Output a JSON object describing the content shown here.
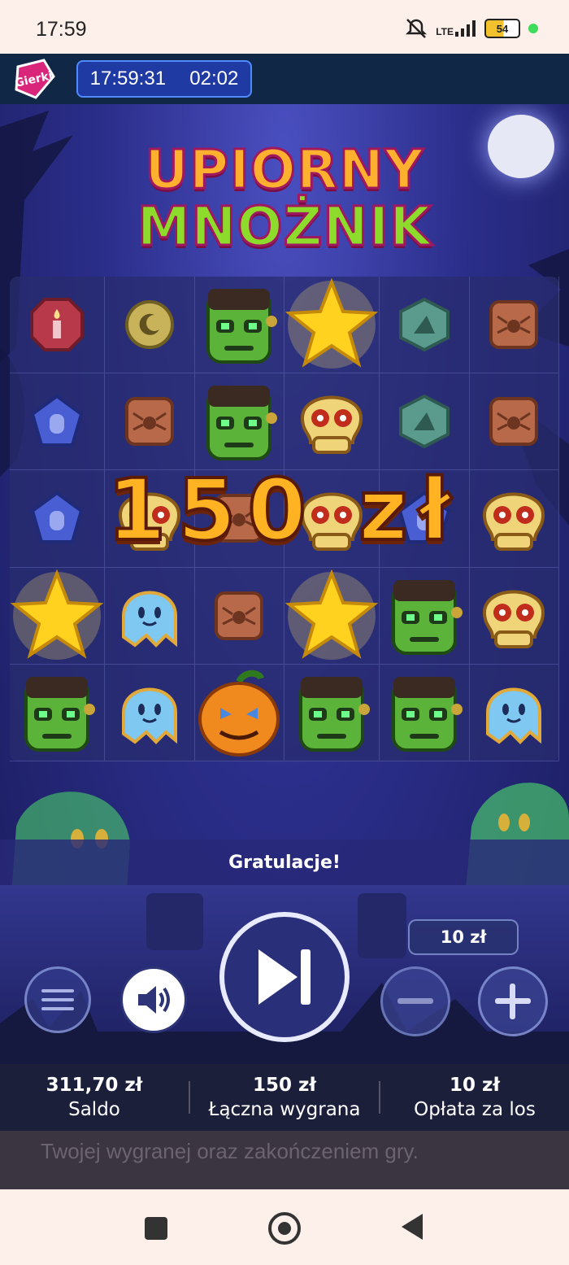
{
  "status_bar": {
    "time": "17:59",
    "network": "LTE",
    "battery": "54"
  },
  "header": {
    "clock_time": "17:59:31",
    "session_timer": "02:02",
    "logo_text": "Gierki"
  },
  "game": {
    "title_line1": "UPIORNY",
    "title_line2": "MNOŻNIK",
    "grid": [
      [
        "candle-gem",
        "moon-coin",
        "frankenstein",
        "star",
        "witch-hat-gem",
        "spider-tile"
      ],
      [
        "tombstone-gem",
        "spider-tile",
        "frankenstein",
        "skull",
        "witch-hat-gem",
        "spider-tile"
      ],
      [
        "tombstone-gem",
        "skull",
        "spider-tile",
        "skull",
        "tombstone-gem",
        "skull"
      ],
      [
        "star",
        "ghost",
        "spider-tile",
        "star",
        "frankenstein",
        "skull"
      ],
      [
        "frankenstein",
        "ghost",
        "pumpkin",
        "frankenstein",
        "frankenstein",
        "ghost"
      ]
    ],
    "win_amount": "150 zł",
    "message": "Gratulacje!"
  },
  "controls": {
    "stake_label": "10 zł"
  },
  "footer": {
    "balance_value": "311,70 zł",
    "balance_label": "Saldo",
    "total_win_value": "150 zł",
    "total_win_label": "Łączna wygrana",
    "fee_value": "10 zł",
    "fee_label": "Opłata za los"
  },
  "underlying_text": "Twojej wygranej oraz zakończeniem gry."
}
